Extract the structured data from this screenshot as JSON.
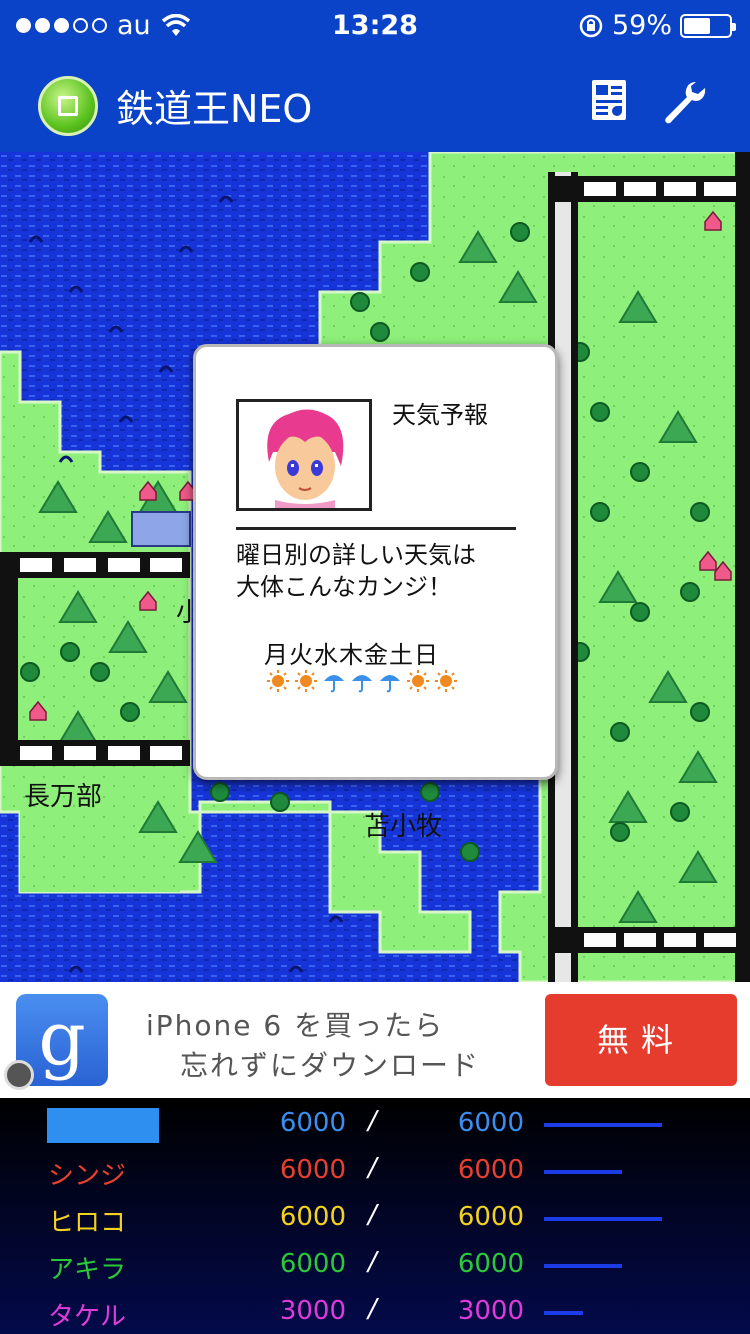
{
  "status_bar": {
    "carrier": "au",
    "time": "13:28",
    "battery_percent": "59%",
    "battery_level": 0.59
  },
  "nav": {
    "title": "鉄道王NEO"
  },
  "map": {
    "labels": [
      {
        "text": "長万部"
      },
      {
        "text": "苫小牧"
      },
      {
        "text": "小"
      }
    ]
  },
  "dialog": {
    "title": "天気予報",
    "line1": "曜日別の詳しい天気は",
    "line2": "大体こんなカンジ！",
    "days": "月火水木金土日",
    "forecast": [
      "sun-icon",
      "sun-icon",
      "umbrella-icon",
      "umbrella-icon",
      "umbrella-icon",
      "sun-icon",
      "sun-icon"
    ]
  },
  "ad": {
    "logo_letter": "g",
    "line1": "iPhone 6 を買ったら",
    "line2": "忘れずにダウンロード",
    "button": "無料"
  },
  "players": [
    {
      "name": "",
      "value": "6000",
      "max": "6000",
      "color": "#3a8ff0",
      "bar": 1.0
    },
    {
      "name": "シンジ",
      "value": "6000",
      "max": "6000",
      "color": "#e8402e",
      "bar": 0.66
    },
    {
      "name": "ヒロコ",
      "value": "6000",
      "max": "6000",
      "color": "#f2d21e",
      "bar": 1.0
    },
    {
      "name": "アキラ",
      "value": "6000",
      "max": "6000",
      "color": "#2cc83a",
      "bar": 0.66
    },
    {
      "name": "タケル",
      "value": "3000",
      "max": "3000",
      "color": "#e03ad8",
      "bar": 0.33
    }
  ],
  "colors": {
    "nav_bg": "#0a43c8",
    "water": "#1634d8",
    "land": "#8ef07a",
    "ad_button": "#e53c2e"
  }
}
